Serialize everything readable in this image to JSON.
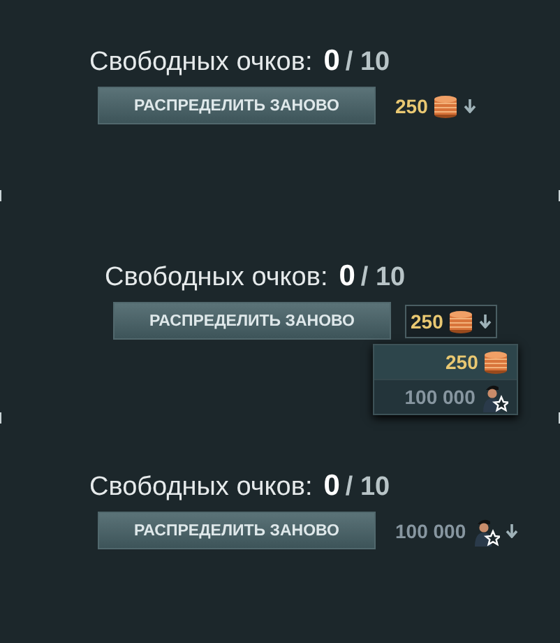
{
  "panels": [
    {
      "label": "Свободных очков:",
      "points": "0",
      "total": "/ 10",
      "button": "РАСПРЕДЕЛИТЬ ЗАНОВО",
      "price": {
        "amount": "250",
        "kind": "coins",
        "affordable": true,
        "expanded": false
      }
    },
    {
      "label": "Свободных очков:",
      "points": "0",
      "total": "/ 10",
      "button": "РАСПРЕДЕЛИТЬ ЗАНОВО",
      "price": {
        "amount": "250",
        "kind": "coins",
        "affordable": true,
        "expanded": true
      },
      "options": [
        {
          "amount": "250",
          "kind": "coins",
          "affordable": true,
          "selected": true
        },
        {
          "amount": "100 000",
          "kind": "commander",
          "affordable": false,
          "selected": false
        }
      ]
    },
    {
      "label": "Свободных очков:",
      "points": "0",
      "total": "/ 10",
      "button": "РАСПРЕДЕЛИТЬ ЗАНОВО",
      "price": {
        "amount": "100 000",
        "kind": "commander",
        "affordable": false,
        "expanded": false
      }
    }
  ]
}
